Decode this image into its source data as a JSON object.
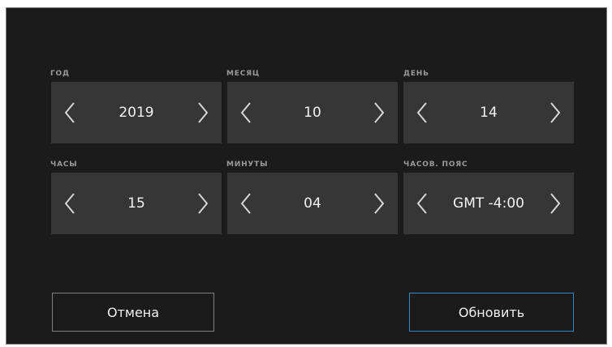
{
  "fields": [
    {
      "label": "ГОД",
      "value": "2019"
    },
    {
      "label": "МЕСЯЦ",
      "value": "10"
    },
    {
      "label": "ДЕНЬ",
      "value": "14"
    },
    {
      "label": "ЧАСЫ",
      "value": "15"
    },
    {
      "label": "МИНУТЫ",
      "value": "04"
    },
    {
      "label": "ЧАСОВ. ПОЯС",
      "value": "GMT -4:00"
    }
  ],
  "buttons": {
    "cancel": "Отмена",
    "update": "Обновить"
  },
  "icons": {
    "decrement": "chevron-left-icon",
    "increment": "chevron-right-icon"
  },
  "colors": {
    "background": "#1b1b1b",
    "stepper": "#363636",
    "label": "#9a9a9a",
    "accent": "#2f86c8"
  }
}
